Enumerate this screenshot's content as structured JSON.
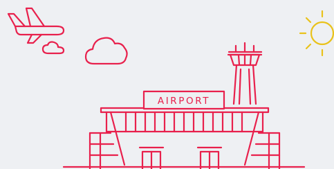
{
  "sign": {
    "text": "AIRPORT"
  },
  "palette": {
    "background": "#eef0f3",
    "line": "#e8204c",
    "sun": "#e9c21a"
  },
  "icons": [
    "airplane-icon",
    "cloud-icon",
    "sun-icon",
    "control-tower-icon",
    "airport-terminal-icon"
  ]
}
